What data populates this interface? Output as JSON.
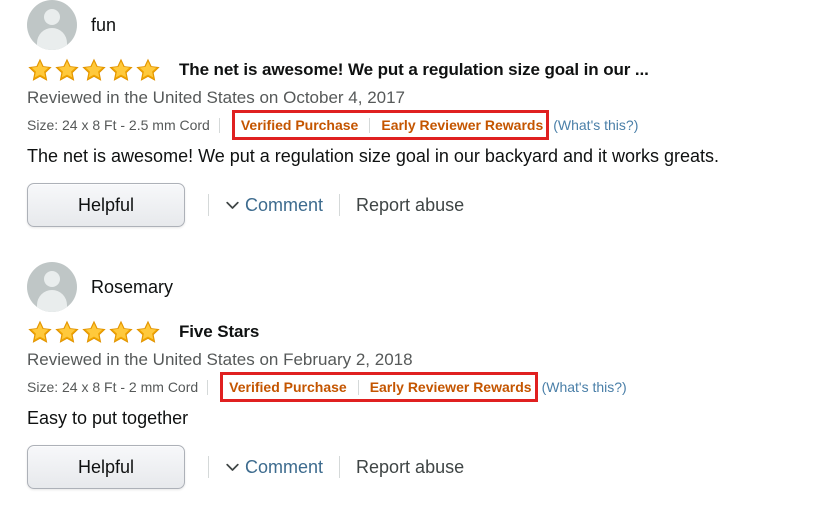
{
  "reviews": [
    {
      "avatar_icon": "user-avatar-icon",
      "author": "fun",
      "rating": 5,
      "rating_label": "5.0 out of 5 stars",
      "title": "The net is awesome! We put a regulation size goal in our ...",
      "reviewed_on": "Reviewed in the United States on October 4, 2017",
      "size": "Size: 24 x 8 Ft - 2.5 mm Cord",
      "verified_purchase": "Verified Purchase",
      "early_reviewer_rewards": "Early Reviewer Rewards",
      "whats_this": "(What's this?)",
      "body": "The net is awesome! We put a regulation size goal in our backyard and it works greats.",
      "helpful_label": "Helpful",
      "comment_label": "Comment",
      "report_abuse_label": "Report abuse",
      "chevron_icon": "chevron-down-icon"
    },
    {
      "avatar_icon": "user-avatar-icon",
      "author": "Rosemary",
      "rating": 5,
      "rating_label": "5.0 out of 5 stars",
      "title": "Five Stars",
      "reviewed_on": "Reviewed in the United States on February 2, 2018",
      "size": "Size: 24 x 8 Ft - 2 mm Cord",
      "verified_purchase": "Verified Purchase",
      "early_reviewer_rewards": "Early Reviewer Rewards",
      "whats_this": "(What's this?)",
      "body": "Easy to put together",
      "helpful_label": "Helpful",
      "comment_label": "Comment",
      "report_abuse_label": "Report abuse",
      "chevron_icon": "chevron-down-icon"
    }
  ],
  "colors": {
    "star_fill": "#F0A500",
    "star_fill_light": "#FFC93C",
    "badge_text": "#C45500",
    "highlight_box": "#E02020",
    "link": "#3D6B8E",
    "whats_this_link": "#4A7FA8",
    "muted_text": "#565959",
    "avatar_bg": "#BFC6C6"
  }
}
